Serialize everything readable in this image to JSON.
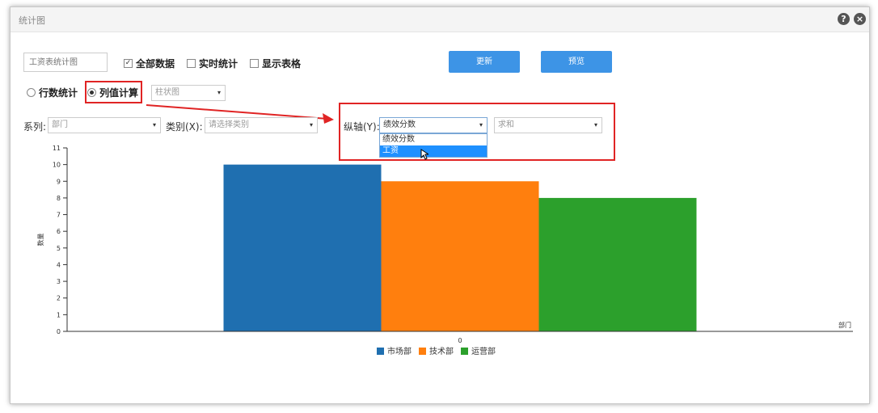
{
  "window": {
    "title": "统计图",
    "help_glyph": "?",
    "close_glyph": "×"
  },
  "toolbar": {
    "name_placeholder": "工资表统计图",
    "all_data": {
      "label": "全部数据",
      "checked": true,
      "mark": "✓"
    },
    "realtime": {
      "label": "实时统计",
      "checked": false
    },
    "show_table": {
      "label": "显示表格",
      "checked": false
    },
    "update_label": "更新",
    "preview_label": "预览"
  },
  "mode": {
    "row_count_label": "行数统计",
    "col_calc_label": "列值计算",
    "selected": "列值计算",
    "chart_type": "柱状图"
  },
  "config": {
    "series_label": "系列:",
    "series_value": "部门",
    "category_label": "类别(X):",
    "category_placeholder": "请选择类别",
    "yaxis_label": "纵轴(Y):",
    "yaxis_value": "绩效分数",
    "yaxis_options": [
      "绩效分数",
      "工资"
    ],
    "yaxis_highlighted": "工资",
    "agg_value": "求和"
  },
  "colors": {
    "accent": "#3d94e6",
    "highlight": "#e02424"
  },
  "chart_data": {
    "type": "bar",
    "categories": [
      "0"
    ],
    "series": [
      {
        "name": "市场部",
        "values": [
          10
        ],
        "color": "#1f6fb0"
      },
      {
        "name": "技术部",
        "values": [
          9
        ],
        "color": "#ff7f0e"
      },
      {
        "name": "运营部",
        "values": [
          8
        ],
        "color": "#2ca02c"
      }
    ],
    "xlabel": "部门",
    "ylabel": "数量",
    "ylim": [
      0,
      11
    ],
    "yticks": [
      0,
      1,
      2,
      3,
      4,
      5,
      6,
      7,
      8,
      9,
      10,
      11
    ],
    "legend_position": "bottom-center",
    "grid": false
  }
}
